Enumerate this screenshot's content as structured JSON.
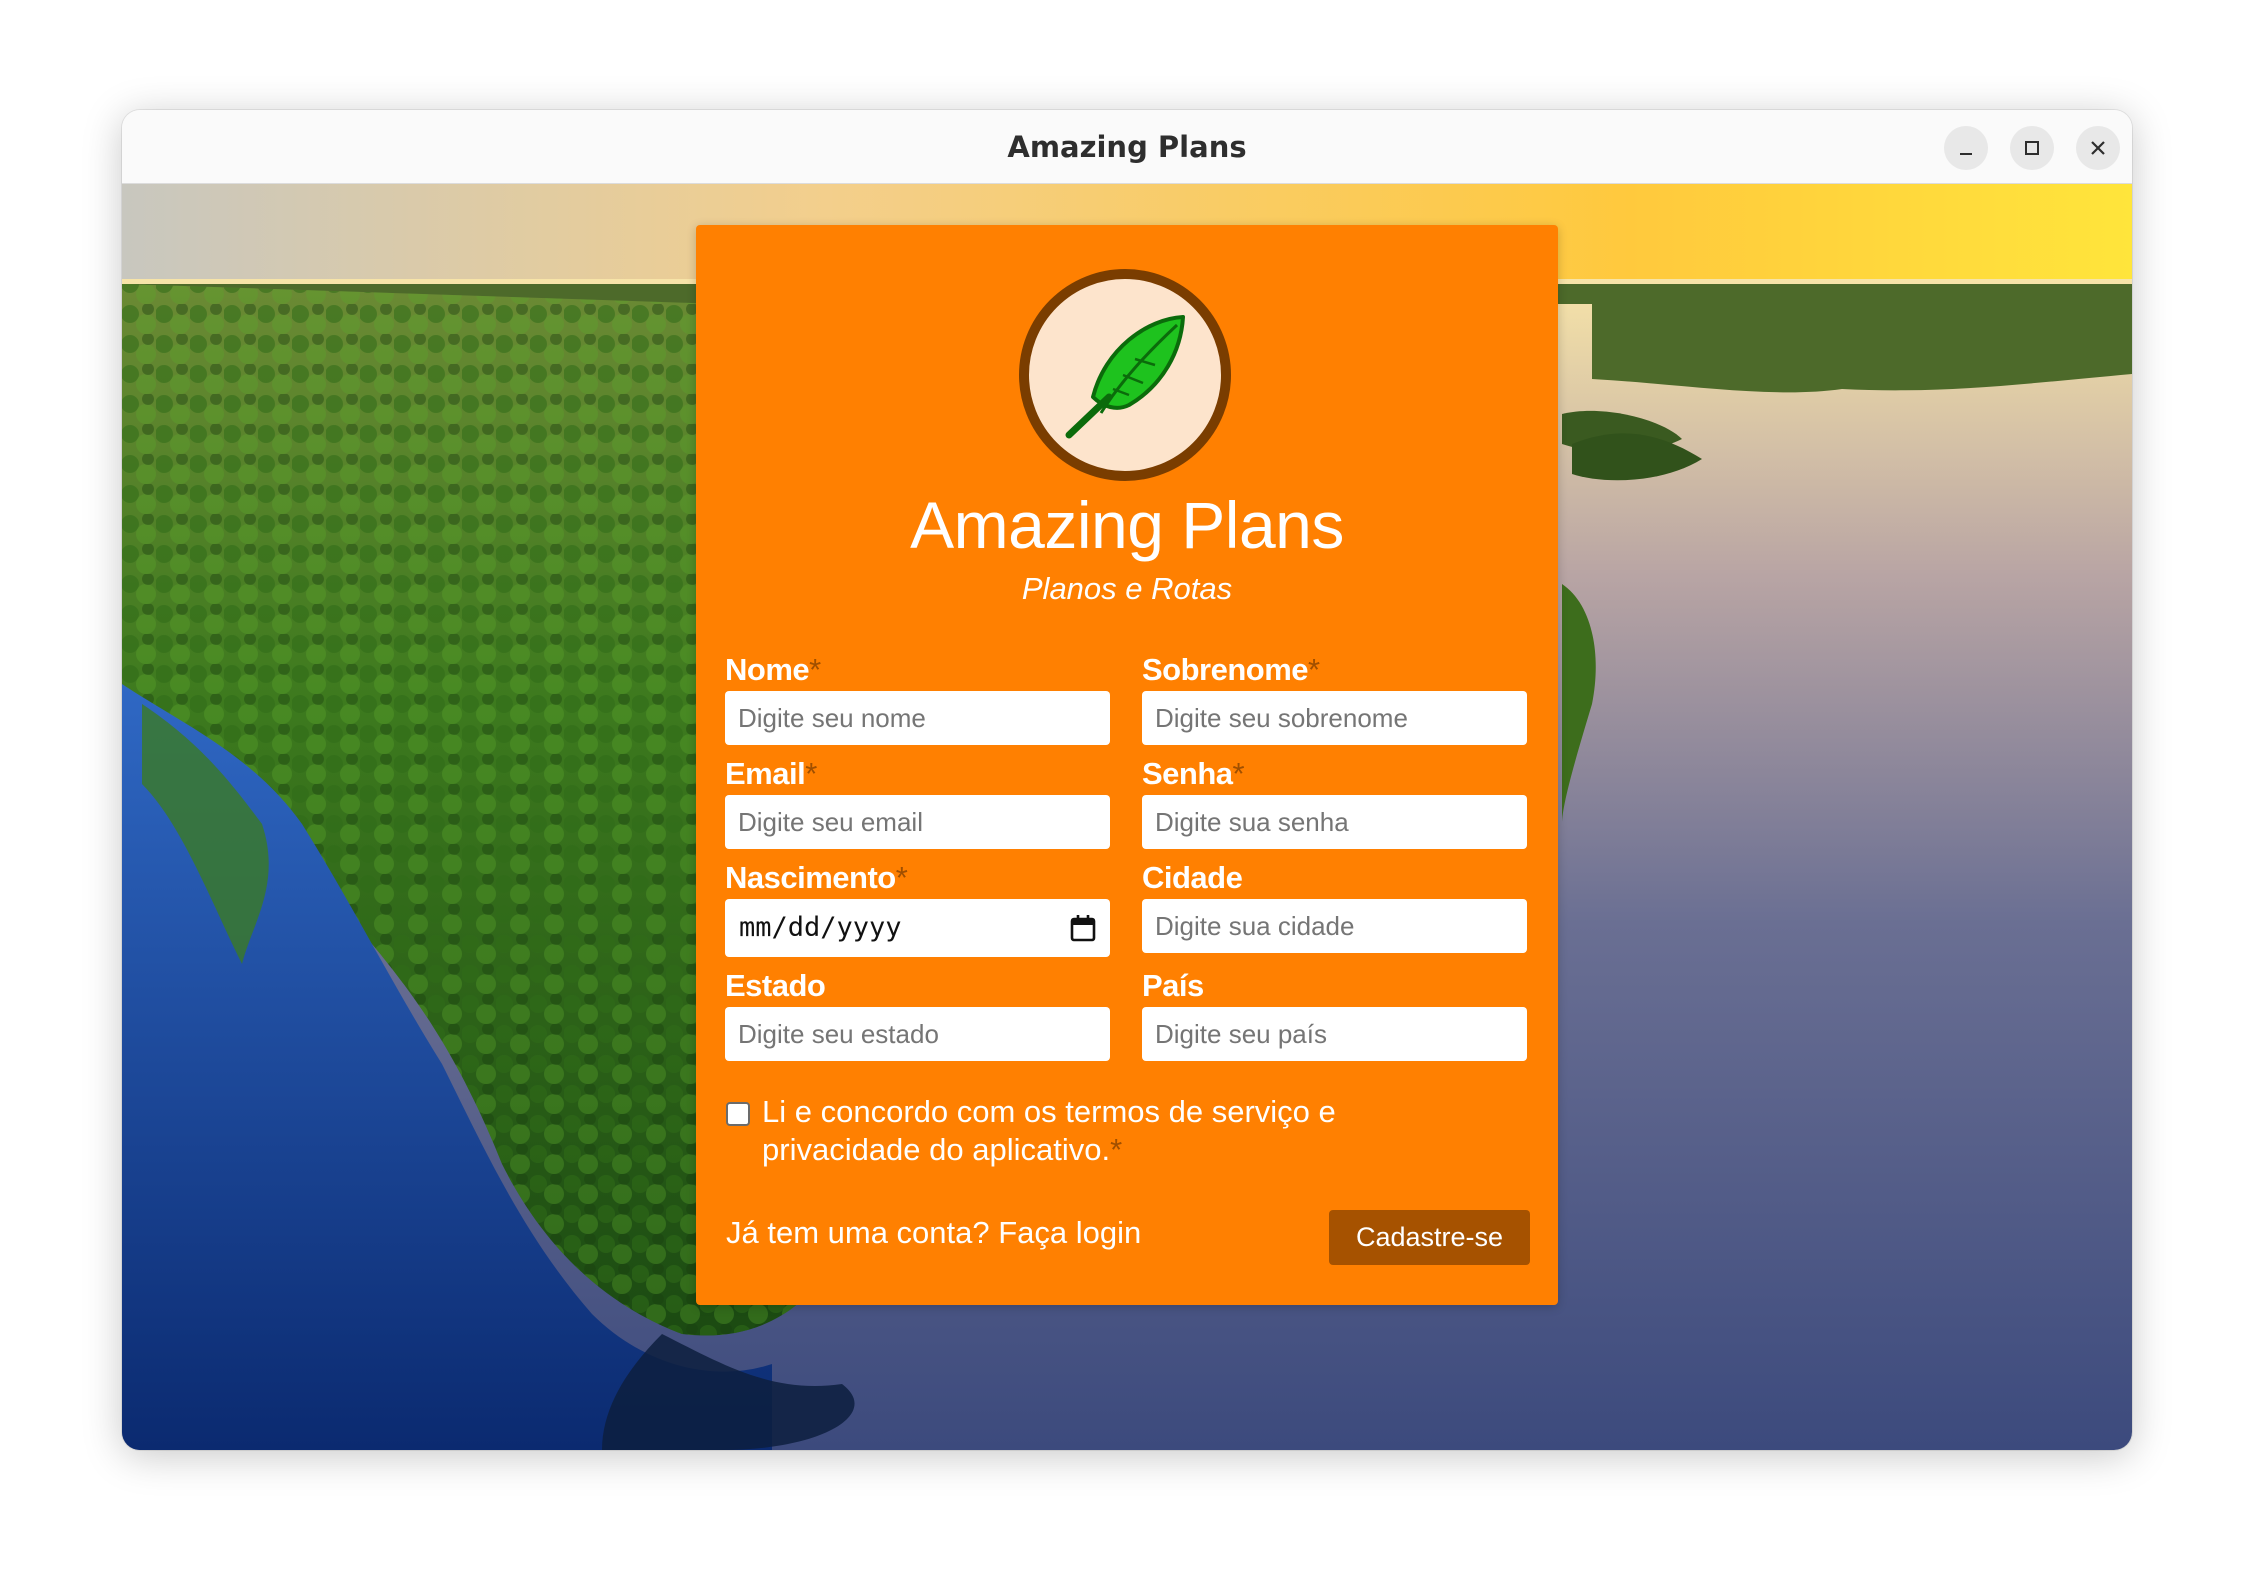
{
  "window": {
    "title": "Amazing Plans"
  },
  "brand": {
    "title": "Amazing Plans",
    "subtitle": "Planos e Rotas",
    "logo_icon": "feather-icon"
  },
  "form": {
    "fields": {
      "nome": {
        "label": "Nome",
        "required_mark": "*",
        "placeholder": "Digite seu nome"
      },
      "sobrenome": {
        "label": "Sobrenome",
        "required_mark": "*",
        "placeholder": "Digite seu sobrenome"
      },
      "email": {
        "label": "Email",
        "required_mark": "*",
        "placeholder": "Digite seu email"
      },
      "senha": {
        "label": "Senha",
        "required_mark": "*",
        "placeholder": "Digite sua senha"
      },
      "nascimento": {
        "label": "Nascimento",
        "required_mark": "*",
        "value": "mm/dd/yyyy"
      },
      "cidade": {
        "label": "Cidade",
        "placeholder": "Digite sua cidade"
      },
      "estado": {
        "label": "Estado",
        "placeholder": "Digite seu estado"
      },
      "pais": {
        "label": "País",
        "placeholder": "Digite seu país"
      }
    },
    "terms": {
      "text": "Li e concordo com os termos de serviço e privacidade do aplicativo.",
      "required_mark": "*",
      "checked": false
    },
    "login_link": "Já tem uma conta? Faça login",
    "submit_label": "Cadastre-se"
  },
  "colors": {
    "card": "#ff8001",
    "button": "#a65200",
    "required_mark": "#a04f00",
    "logo_ring": "#7a3d00",
    "logo_fill": "#fde4cc",
    "feather": "#1ec21e"
  }
}
